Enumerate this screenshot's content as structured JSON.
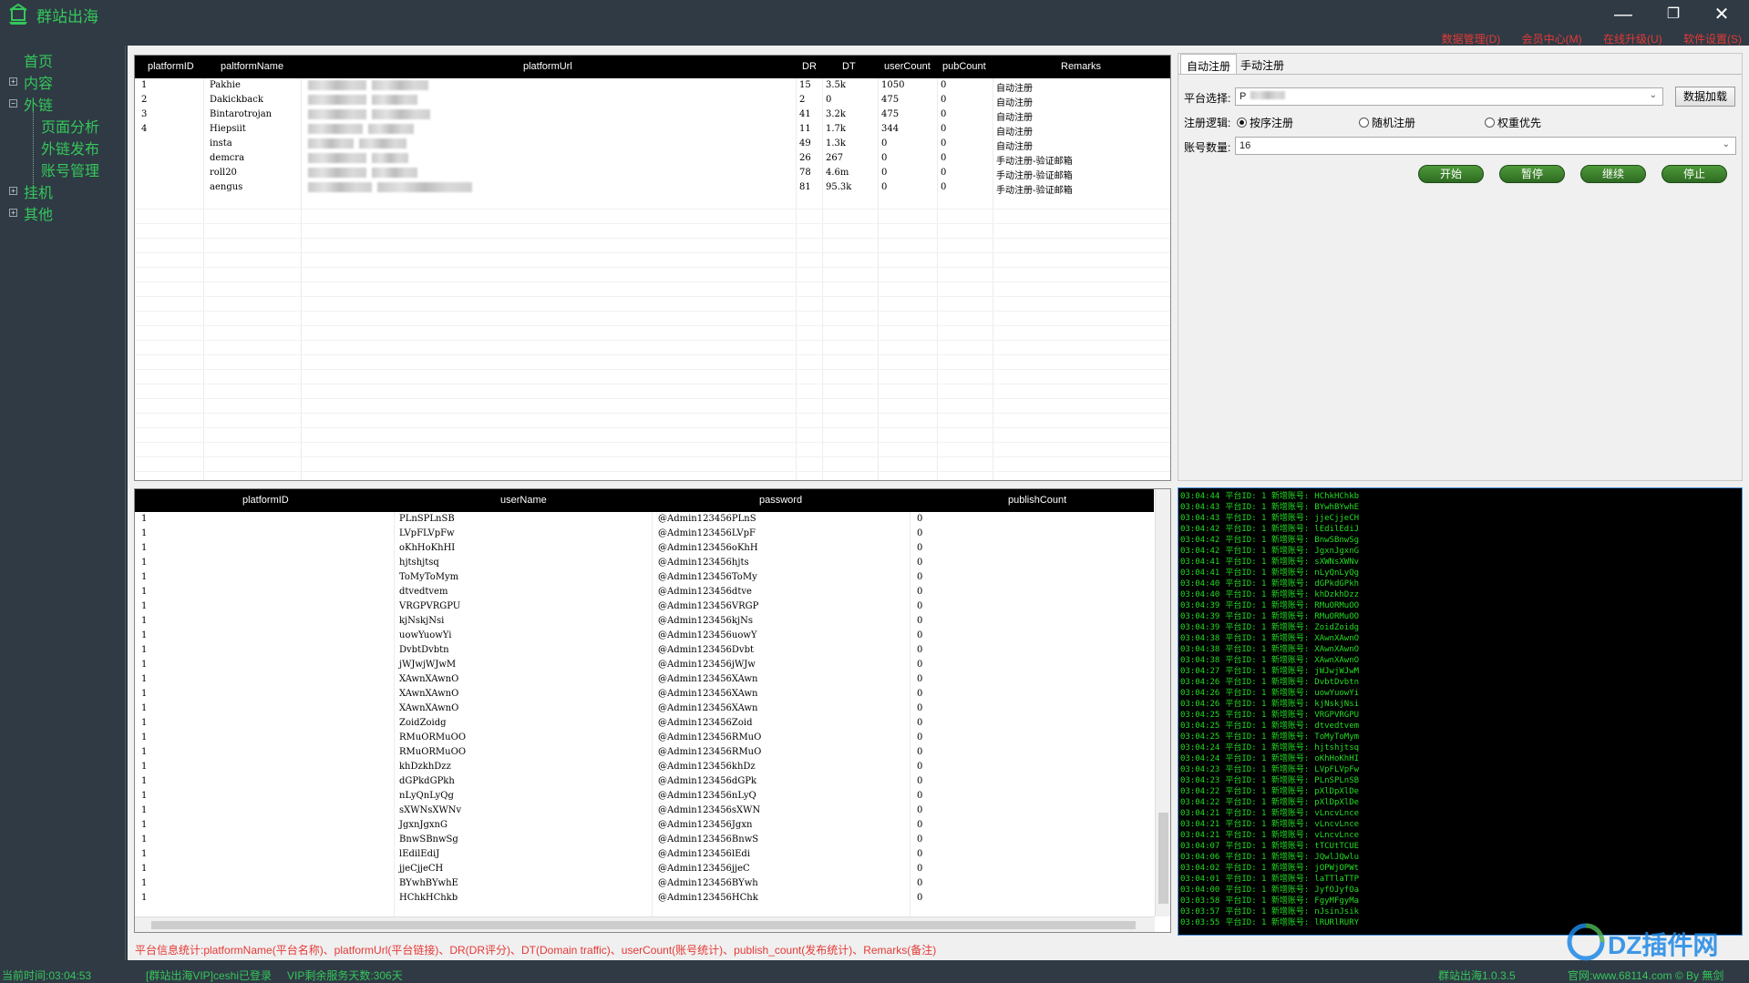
{
  "app": {
    "title": "群站出海",
    "win_controls": {
      "minimize": "—",
      "maximize": "❐",
      "close": "✕"
    },
    "menu": [
      "数据管理(D)",
      "会员中心(M)",
      "在线升级(U)",
      "软件设置(S)"
    ]
  },
  "sidebar": {
    "items": [
      {
        "label": "首页",
        "toggle": ""
      },
      {
        "label": "内容",
        "toggle": "+"
      },
      {
        "label": "外链",
        "toggle": "−"
      },
      {
        "label": "页面分析",
        "toggle": ""
      },
      {
        "label": "外链发布",
        "toggle": ""
      },
      {
        "label": "账号管理",
        "toggle": ""
      },
      {
        "label": "挂机",
        "toggle": "+"
      },
      {
        "label": "其他",
        "toggle": "+"
      }
    ]
  },
  "platform_grid": {
    "columns": [
      "platformID",
      "paltformName",
      "platformUrl",
      "DR",
      "DT",
      "userCount",
      "pubCount",
      "Remarks"
    ],
    "rows": [
      {
        "id": "1",
        "name": "Pakhie",
        "dr": "15",
        "dt": "3.5k",
        "user": "1050",
        "pub": "0",
        "remark": "自动注册"
      },
      {
        "id": "2",
        "name": "Dakickback",
        "dr": "2",
        "dt": "0",
        "user": "475",
        "pub": "0",
        "remark": "自动注册"
      },
      {
        "id": "3",
        "name": "Bintarotrojan",
        "dr": "41",
        "dt": "3.2k",
        "user": "475",
        "pub": "0",
        "remark": "自动注册"
      },
      {
        "id": "4",
        "name": "Hiepsiit",
        "dr": "11",
        "dt": "1.7k",
        "user": "344",
        "pub": "0",
        "remark": "自动注册"
      },
      {
        "id": "",
        "name": "insta",
        "dr": "49",
        "dt": "1.3k",
        "user": "0",
        "pub": "0",
        "remark": "自动注册"
      },
      {
        "id": "",
        "name": "demcra",
        "dr": "26",
        "dt": "267",
        "user": "0",
        "pub": "0",
        "remark": "手动注册-验证邮箱"
      },
      {
        "id": "",
        "name": "roll20",
        "dr": "78",
        "dt": "4.6m",
        "user": "0",
        "pub": "0",
        "remark": "手动注册-验证邮箱"
      },
      {
        "id": "",
        "name": "aengus",
        "dr": "81",
        "dt": "95.3k",
        "user": "0",
        "pub": "0",
        "remark": "手动注册-验证邮箱"
      }
    ]
  },
  "account_grid": {
    "columns": [
      "platformID",
      "userName",
      "password",
      "publishCount"
    ],
    "rows": [
      [
        "1",
        "PLnSPLnSB",
        "@Admin123456PLnS",
        "0"
      ],
      [
        "1",
        "LVpFLVpFw",
        "@Admin123456LVpF",
        "0"
      ],
      [
        "1",
        "oKhHoKhHI",
        "@Admin123456oKhH",
        "0"
      ],
      [
        "1",
        "hjtshjtsq",
        "@Admin123456hjts",
        "0"
      ],
      [
        "1",
        "ToMyToMym",
        "@Admin123456ToMy",
        "0"
      ],
      [
        "1",
        "dtvedtvem",
        "@Admin123456dtve",
        "0"
      ],
      [
        "1",
        "VRGPVRGPU",
        "@Admin123456VRGP",
        "0"
      ],
      [
        "1",
        "kjNskjNsi",
        "@Admin123456kjNs",
        "0"
      ],
      [
        "1",
        "uowYuowYi",
        "@Admin123456uowY",
        "0"
      ],
      [
        "1",
        "DvbtDvbtn",
        "@Admin123456Dvbt",
        "0"
      ],
      [
        "1",
        "jWJwjWJwM",
        "@Admin123456jWJw",
        "0"
      ],
      [
        "1",
        "XAwnXAwnO",
        "@Admin123456XAwn",
        "0"
      ],
      [
        "1",
        "XAwnXAwnO",
        "@Admin123456XAwn",
        "0"
      ],
      [
        "1",
        "XAwnXAwnO",
        "@Admin123456XAwn",
        "0"
      ],
      [
        "1",
        "ZoidZoidg",
        "@Admin123456Zoid",
        "0"
      ],
      [
        "1",
        "RMuORMuOO",
        "@Admin123456RMuO",
        "0"
      ],
      [
        "1",
        "RMuORMuOO",
        "@Admin123456RMuO",
        "0"
      ],
      [
        "1",
        "khDzkhDzz",
        "@Admin123456khDz",
        "0"
      ],
      [
        "1",
        "dGPkdGPkh",
        "@Admin123456dGPk",
        "0"
      ],
      [
        "1",
        "nLyQnLyQg",
        "@Admin123456nLyQ",
        "0"
      ],
      [
        "1",
        "sXWNsXWNv",
        "@Admin123456sXWN",
        "0"
      ],
      [
        "1",
        "JgxnJgxnG",
        "@Admin123456Jgxn",
        "0"
      ],
      [
        "1",
        "BnwSBnwSg",
        "@Admin123456BnwS",
        "0"
      ],
      [
        "1",
        "lEdilEdiJ",
        "@Admin123456lEdi",
        "0"
      ],
      [
        "1",
        "jjeCjjeCH",
        "@Admin123456jjeC",
        "0"
      ],
      [
        "1",
        "BYwhBYwhE",
        "@Admin123456BYwh",
        "0"
      ],
      [
        "1",
        "HChkHChkb",
        "@Admin123456HChk",
        "0"
      ]
    ]
  },
  "register_panel": {
    "tabs": [
      "自动注册",
      "手动注册"
    ],
    "platform_label": "平台选择:",
    "platform_value": "P",
    "load_button": "数据加载",
    "logic_label": "注册逻辑:",
    "logic_options": [
      "按序注册",
      "随机注册",
      "权重优先"
    ],
    "count_label": "账号数量:",
    "count_value": "16",
    "actions": [
      "开始",
      "暂停",
      "继续",
      "停止"
    ]
  },
  "console": {
    "prefix": "平台ID: 1 新增账号:",
    "lines": [
      [
        "03:04:44",
        "HChkHChkb"
      ],
      [
        "03:04:43",
        "BYwhBYwhE"
      ],
      [
        "03:04:43",
        "jjeCjjeCH"
      ],
      [
        "03:04:42",
        "lEdilEdiJ"
      ],
      [
        "03:04:42",
        "BnwSBnwSg"
      ],
      [
        "03:04:42",
        "JgxnJgxnG"
      ],
      [
        "03:04:41",
        "sXWNsXWNv"
      ],
      [
        "03:04:41",
        "nLyQnLyQg"
      ],
      [
        "03:04:40",
        "dGPkdGPkh"
      ],
      [
        "03:04:40",
        "khDzkhDzz"
      ],
      [
        "03:04:39",
        "RMuORMuOO"
      ],
      [
        "03:04:39",
        "RMuORMuOO"
      ],
      [
        "03:04:39",
        "ZoidZoidg"
      ],
      [
        "03:04:38",
        "XAwnXAwnO"
      ],
      [
        "03:04:38",
        "XAwnXAwnO"
      ],
      [
        "03:04:38",
        "XAwnXAwnO"
      ],
      [
        "03:04:27",
        "jWJwjWJwM"
      ],
      [
        "03:04:26",
        "DvbtDvbtn"
      ],
      [
        "03:04:26",
        "uowYuowYi"
      ],
      [
        "03:04:26",
        "kjNskjNsi"
      ],
      [
        "03:04:25",
        "VRGPVRGPU"
      ],
      [
        "03:04:25",
        "dtvedtvem"
      ],
      [
        "03:04:25",
        "ToMyToMym"
      ],
      [
        "03:04:24",
        "hjtshjtsq"
      ],
      [
        "03:04:24",
        "oKhHoKhHI"
      ],
      [
        "03:04:23",
        "LVpFLVpFw"
      ],
      [
        "03:04:23",
        "PLnSPLnSB"
      ],
      [
        "03:04:22",
        "pXlDpXlDe"
      ],
      [
        "03:04:22",
        "pXlDpXlDe"
      ],
      [
        "03:04:21",
        "vLncvLnce"
      ],
      [
        "03:04:21",
        "vLncvLnce"
      ],
      [
        "03:04:21",
        "vLncvLnce"
      ],
      [
        "03:04:07",
        "tTCUtTCUE"
      ],
      [
        "03:04:06",
        "JQwlJQwlu"
      ],
      [
        "03:04:02",
        "jOPWjOPWt"
      ],
      [
        "03:04:01",
        "laTTlaTTP"
      ],
      [
        "03:04:00",
        "JyfOJyfOa"
      ],
      [
        "03:03:58",
        "FgyMFgyMa"
      ],
      [
        "03:03:57",
        "nJsinJsik"
      ],
      [
        "03:03:55",
        "lRURlRURY"
      ]
    ]
  },
  "info_line": "平台信息统计:platformName(平台名称)、platformUrl(平台链接)、DR(DR评分)、DT(Domain traffic)、userCount(账号统计)、publish_count(发布统计)、Remarks(备注)",
  "footer": {
    "time": "当前时间:03:04:53",
    "user": "[群站出海VIP]ceshi已登录",
    "vip": "VIP剩余服务天数:306天",
    "version": "群站出海1.0.3.5",
    "site": "官网:www.68114.com © By 無剑"
  },
  "watermark": "DZ插件网"
}
